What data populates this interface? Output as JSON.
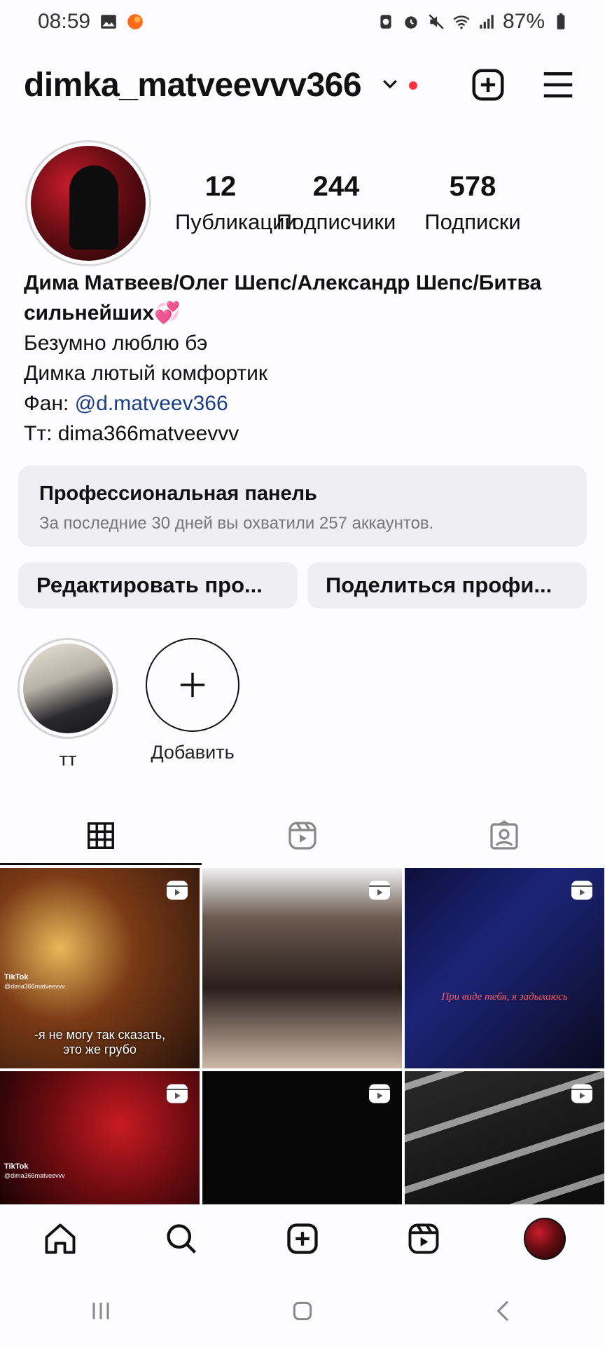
{
  "status_bar": {
    "time": "08:59",
    "battery": "87%",
    "icons": [
      "image-icon",
      "app-notification-icon",
      "recycle-icon",
      "alarm-icon",
      "mute-icon",
      "wifi-icon",
      "signal-icon",
      "battery-icon"
    ]
  },
  "header": {
    "username": "dimka_matveevvv366",
    "icons": [
      "chevron-down-icon",
      "create-post-icon",
      "menu-icon"
    ],
    "notification_dot_color": "#ff3040"
  },
  "profile": {
    "stats": [
      {
        "value": "12",
        "label": "Публикации"
      },
      {
        "value": "244",
        "label": "Подписчики"
      },
      {
        "value": "578",
        "label": "Подписки"
      }
    ],
    "bio": {
      "name": "Дима Матвеев/Олег Шепс/Александр Шепс/Битва сильнейших💞",
      "line1": "Безумно люблю бэ",
      "line2": "Димка лютый комфортик",
      "fan_prefix": "Фан: ",
      "fan_mention": "@d.matveev366",
      "line4": "Тт: dima366matveevvv"
    }
  },
  "pro_panel": {
    "title": "Профессиональная панель",
    "subtitle": "За последние 30 дней вы охватили 257 аккаунтов."
  },
  "actions": {
    "edit": "Редактировать про...",
    "share": "Поделиться профи..."
  },
  "highlights": [
    {
      "label": "тт"
    },
    {
      "label": "Добавить"
    }
  ],
  "tabs": [
    "grid-icon",
    "reels-icon",
    "tagged-icon"
  ],
  "grid": {
    "captions": {
      "c1": "-я не могу так сказать,\nэто же грубо",
      "c3": "При виде тебя, я задыхаюсь",
      "tiktok_label": "TikTok",
      "tiktok_user": "@dima366matveevvv"
    }
  },
  "bottom_nav": [
    "home-icon",
    "search-icon",
    "create-icon",
    "reels-icon",
    "profile-avatar"
  ],
  "colors": {
    "accent_link": "#1c3e85",
    "panel_bg": "#efeef2",
    "background": "#fdfcfe"
  }
}
